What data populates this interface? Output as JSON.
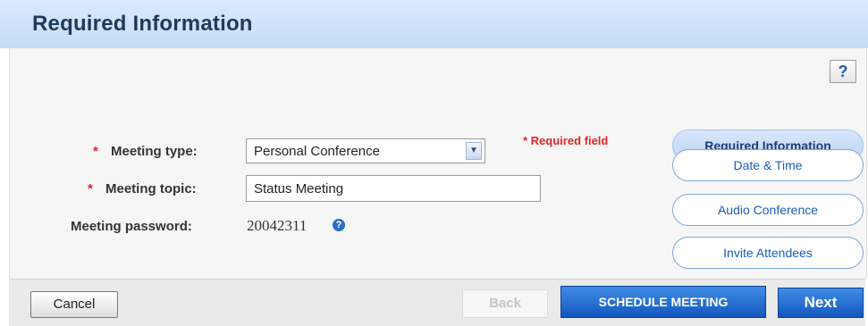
{
  "header": {
    "title": "Required Information"
  },
  "help": {
    "label": "?"
  },
  "form": {
    "required_note": "* Required field",
    "required_marker": "*",
    "meeting_type": {
      "label": "Meeting type:",
      "value": "Personal Conference"
    },
    "meeting_topic": {
      "label": "Meeting topic:",
      "value": "Status Meeting"
    },
    "meeting_password": {
      "label": "Meeting password:",
      "value": "20042311"
    }
  },
  "steps": [
    {
      "label": "Required Information",
      "active": true
    },
    {
      "label": "Date & Time",
      "active": false
    },
    {
      "label": "Audio Conference",
      "active": false
    },
    {
      "label": "Invite Attendees",
      "active": false
    }
  ],
  "footer": {
    "cancel": "Cancel",
    "back": "Back",
    "schedule": "SCHEDULE MEETING",
    "next": "Next"
  },
  "icons": {
    "help": "question-icon",
    "info": "info-icon",
    "dropdown": "chevron-down-icon"
  }
}
